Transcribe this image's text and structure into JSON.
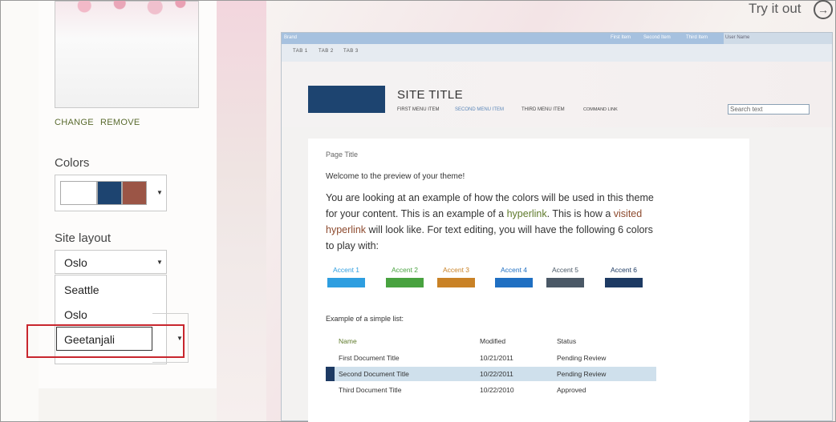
{
  "try_it_out": {
    "label": "Try it out"
  },
  "image_actions": {
    "change": "CHANGE",
    "remove": "REMOVE"
  },
  "colors": {
    "label": "Colors",
    "swatches": [
      "#ffffff",
      "#1d4470",
      "#9b5546"
    ]
  },
  "site_layout": {
    "label": "Site layout",
    "selected": "Oslo",
    "options": [
      "Seattle",
      "Oslo",
      "Geetanjali"
    ],
    "highlighted": "Geetanjali"
  },
  "preview": {
    "suite_bar": {
      "brand": "Brand",
      "links": [
        "First Item",
        "Second Item",
        "Third Item"
      ],
      "user": "User Name"
    },
    "tabs": [
      "TAB 1",
      "TAB 2",
      "TAB 3"
    ],
    "site_title": "SITE TITLE",
    "menu": [
      "FIRST MENU ITEM",
      "SECOND MENU ITEM",
      "THIRD MENU ITEM",
      "COMMAND LINK"
    ],
    "search_placeholder": "Search text",
    "page_title": "Page Title",
    "welcome": "Welcome to the preview of your theme!",
    "body": {
      "p1": "You are looking at an example of how the colors will be used in this theme for your content. This is an example of a ",
      "hyperlink": "hyperlink",
      "p2": ". This is how a ",
      "visited": "visited hyperlink",
      "p3": " will look like. For text editing, you will have the following 6 colors to play with:"
    },
    "accents": [
      {
        "label": "Accent 1",
        "color": "#2e9ee0"
      },
      {
        "label": "Accent 2",
        "color": "#48a23f"
      },
      {
        "label": "Accent 3",
        "color": "#c98226"
      },
      {
        "label": "Accent 4",
        "color": "#1f6fc2"
      },
      {
        "label": "Accent 5",
        "color": "#4a5866"
      },
      {
        "label": "Accent 6",
        "color": "#1d3a63"
      }
    ],
    "list_caption": "Example of a simple list:",
    "list_headers": [
      "Name",
      "Modified",
      "Status"
    ],
    "list_rows": [
      {
        "name": "First Document Title",
        "modified": "10/21/2011",
        "status": "Pending Review"
      },
      {
        "name": "Second Document Title",
        "modified": "10/22/2011",
        "status": "Pending Review"
      },
      {
        "name": "Third Document Title",
        "modified": "10/22/2010",
        "status": "Approved"
      }
    ]
  }
}
